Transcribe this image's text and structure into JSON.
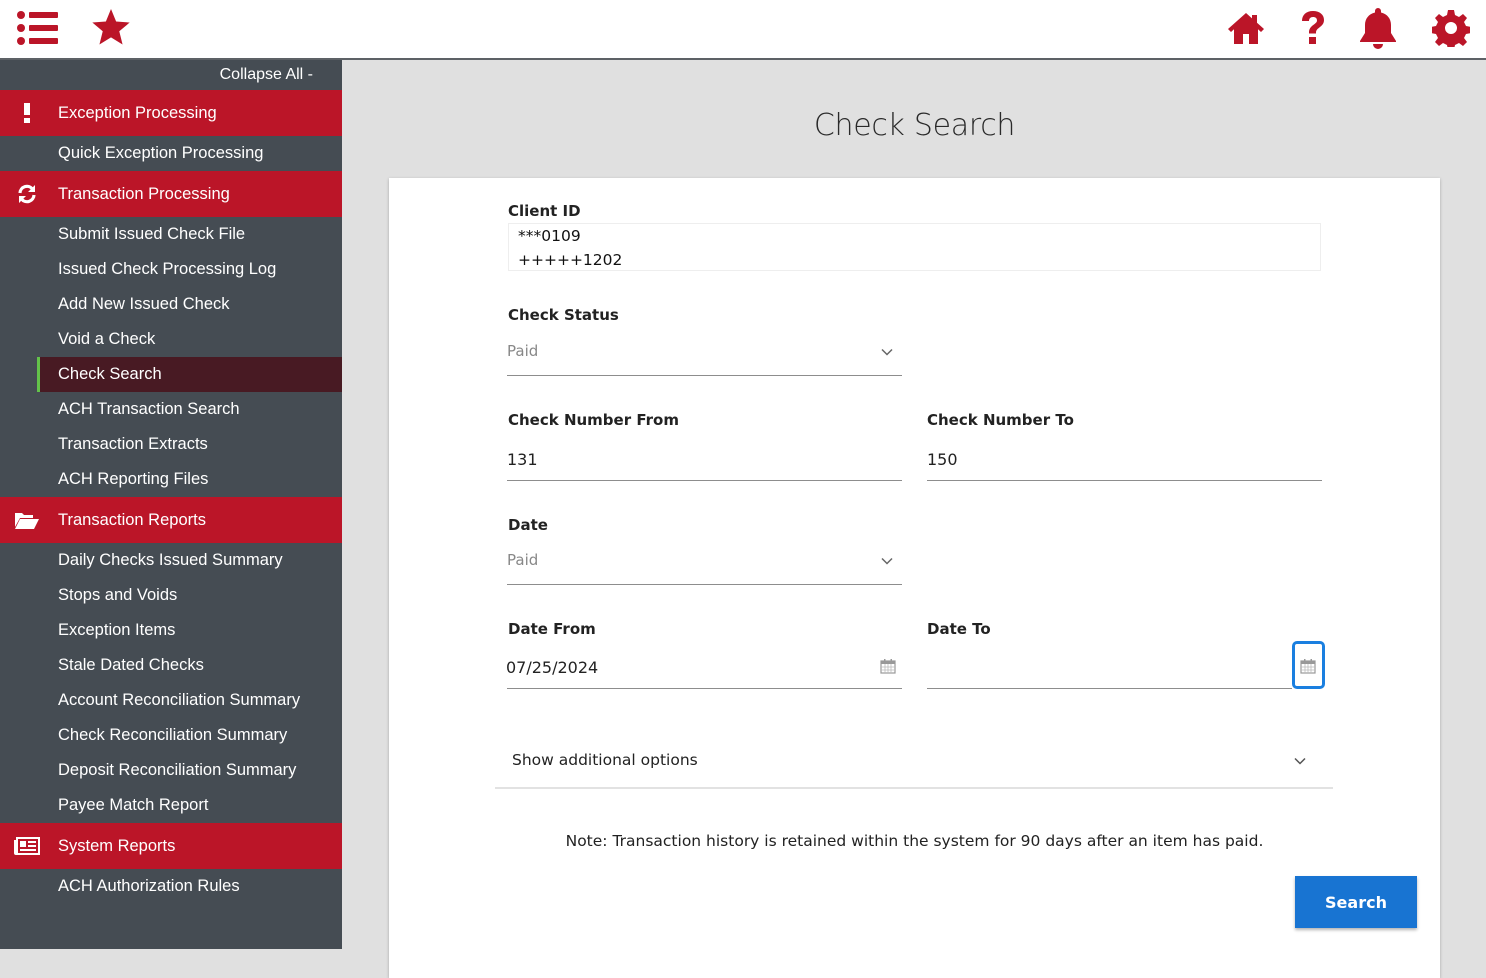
{
  "topbar": {
    "left_icons": [
      "list-menu-icon",
      "star-favorites-icon"
    ],
    "right_icons": [
      "home-icon",
      "help-icon",
      "bell-notifications-icon",
      "gear-settings-icon"
    ],
    "brand_color": "#bb1528"
  },
  "sidebar": {
    "collapse_label": "Collapse All -",
    "sections": [
      {
        "label": "Exception Processing",
        "icon": "exclamation-icon",
        "items": [
          "Quick Exception Processing"
        ]
      },
      {
        "label": "Transaction Processing",
        "icon": "refresh-icon",
        "items": [
          "Submit Issued Check File",
          "Issued Check Processing Log",
          "Add New Issued Check",
          "Void a Check",
          "Check Search",
          "ACH Transaction Search",
          "Transaction Extracts",
          "ACH Reporting Files"
        ]
      },
      {
        "label": "Transaction Reports",
        "icon": "folder-open-icon",
        "items": [
          "Daily Checks Issued Summary",
          "Stops and Voids",
          "Exception Items",
          "Stale Dated Checks",
          "Account Reconciliation Summary",
          "Check Reconciliation Summary",
          "Deposit Reconciliation Summary",
          "Payee Match Report"
        ]
      },
      {
        "label": "System Reports",
        "icon": "newspaper-icon",
        "items": [
          "ACH Authorization Rules"
        ]
      }
    ],
    "active_item": "Check Search"
  },
  "page": {
    "title": "Check Search",
    "form": {
      "client_id": {
        "label": "Client ID",
        "values": [
          "***0109",
          "+++++1202"
        ]
      },
      "check_status": {
        "label": "Check Status",
        "value": "Paid"
      },
      "check_number_from": {
        "label": "Check Number From",
        "value": "131"
      },
      "check_number_to": {
        "label": "Check Number To",
        "value": "150"
      },
      "date": {
        "label": "Date",
        "value": "Paid"
      },
      "date_from": {
        "label": "Date From",
        "value": "07/25/2024"
      },
      "date_to": {
        "label": "Date To",
        "value": ""
      },
      "additional_options_label": "Show additional options",
      "note": "Note: Transaction history is retained within the system for 90 days after an item has paid.",
      "search_button": "Search"
    }
  }
}
